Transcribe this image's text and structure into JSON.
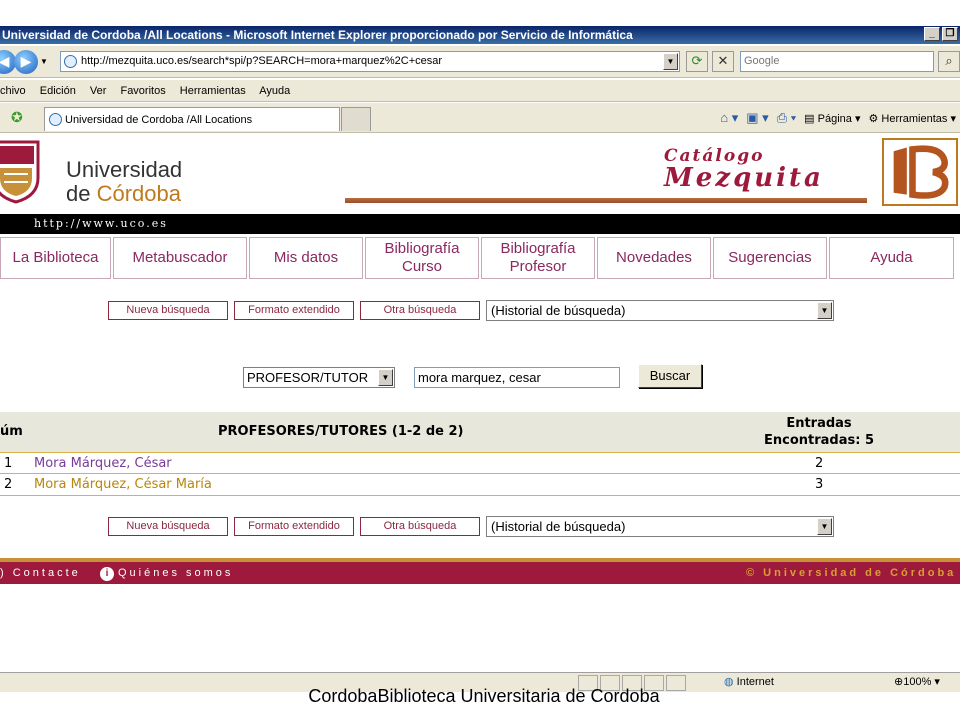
{
  "browser": {
    "window_title": "Universidad de Cordoba /All Locations - Microsoft Internet Explorer proporcionado por Servicio de Informática",
    "address": "http://mezquita.uco.es/search*spi/p?SEARCH=mora+marquez%2C+cesar",
    "search_placeholder": "Google",
    "menu": [
      "chivo",
      "Edición",
      "Ver",
      "Favoritos",
      "Herramientas",
      "Ayuda"
    ],
    "tab_label": "Universidad de Cordoba /All Locations",
    "cmd_page": "Página",
    "cmd_tools": "Herramientas",
    "status_zone": "Internet",
    "status_zoom": "100%"
  },
  "header": {
    "uni_line1": "Universidad",
    "uni_line2_prefix": "de ",
    "uni_line2_accent": "Córdoba",
    "catalog_l1": "Catálogo",
    "catalog_l2": "Mezquita",
    "url_strip": "http://www.uco.es"
  },
  "nav": [
    {
      "label": "La Biblioteca",
      "w": 111
    },
    {
      "label": "Metabuscador",
      "w": 134
    },
    {
      "label": "Mis datos",
      "w": 114
    },
    {
      "label": "Bibliografía\nCurso",
      "w": 114
    },
    {
      "label": "Bibliografía\nProfesor",
      "w": 114
    },
    {
      "label": "Novedades",
      "w": 114
    },
    {
      "label": "Sugerencias",
      "w": 114
    },
    {
      "label": "Ayuda",
      "w": 125
    }
  ],
  "actions": {
    "new_search": "Nueva búsqueda",
    "extended": "Formato extendido",
    "other": "Otra búsqueda",
    "history": "(Historial de búsqueda)"
  },
  "search": {
    "type": "PROFESOR/TUTOR",
    "query": "mora marquez, cesar",
    "button": "Buscar"
  },
  "results": {
    "col_num": "úm",
    "col_title": "PROFESORES/TUTORES (1-2 de 2)",
    "col_entries_l1": "Entradas",
    "col_entries_l2": "Encontradas: 5",
    "rows": [
      {
        "n": "1",
        "name": "Mora Márquez, César",
        "count": "2",
        "color": "#7a3a9a"
      },
      {
        "n": "2",
        "name": "Mora Márquez, César María",
        "count": "3",
        "color": "#b8860b"
      }
    ]
  },
  "footer": {
    "contact": "Contacte",
    "about": "Quiénes somos",
    "copyright": "© Universidad de Córdoba"
  },
  "caption": "CordobaBiblioteca Universitaria de Cordoba",
  "colors": {
    "brand": "#9e1a3c",
    "accent_gold": "#c89038",
    "nav_text": "#8a2860"
  }
}
